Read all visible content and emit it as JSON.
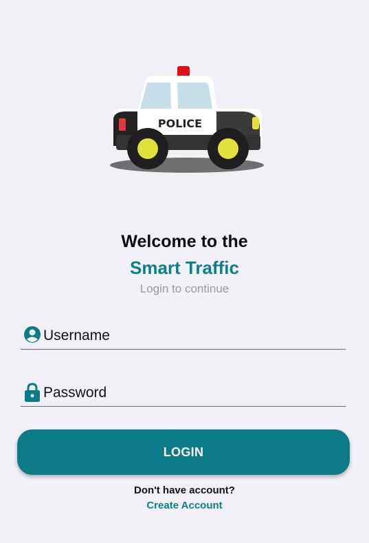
{
  "header": {
    "welcome": "Welcome to the",
    "app_name": "Smart Traffic",
    "subtitle": "Login to continue"
  },
  "logo": {
    "icon": "police-car-icon",
    "text": "POLICE"
  },
  "form": {
    "username": {
      "placeholder": "Username",
      "value": "",
      "icon": "account-circle-icon"
    },
    "password": {
      "placeholder": "Password",
      "value": "",
      "icon": "lock-icon"
    },
    "login_label": "LOGIN"
  },
  "footer": {
    "prompt": "Don't have account?",
    "create_account": "Create Account"
  },
  "colors": {
    "background": "#f1f0f7",
    "accent": "#0b7b87",
    "title_accent": "#0d7f89",
    "muted_text": "#9b9b9f"
  }
}
